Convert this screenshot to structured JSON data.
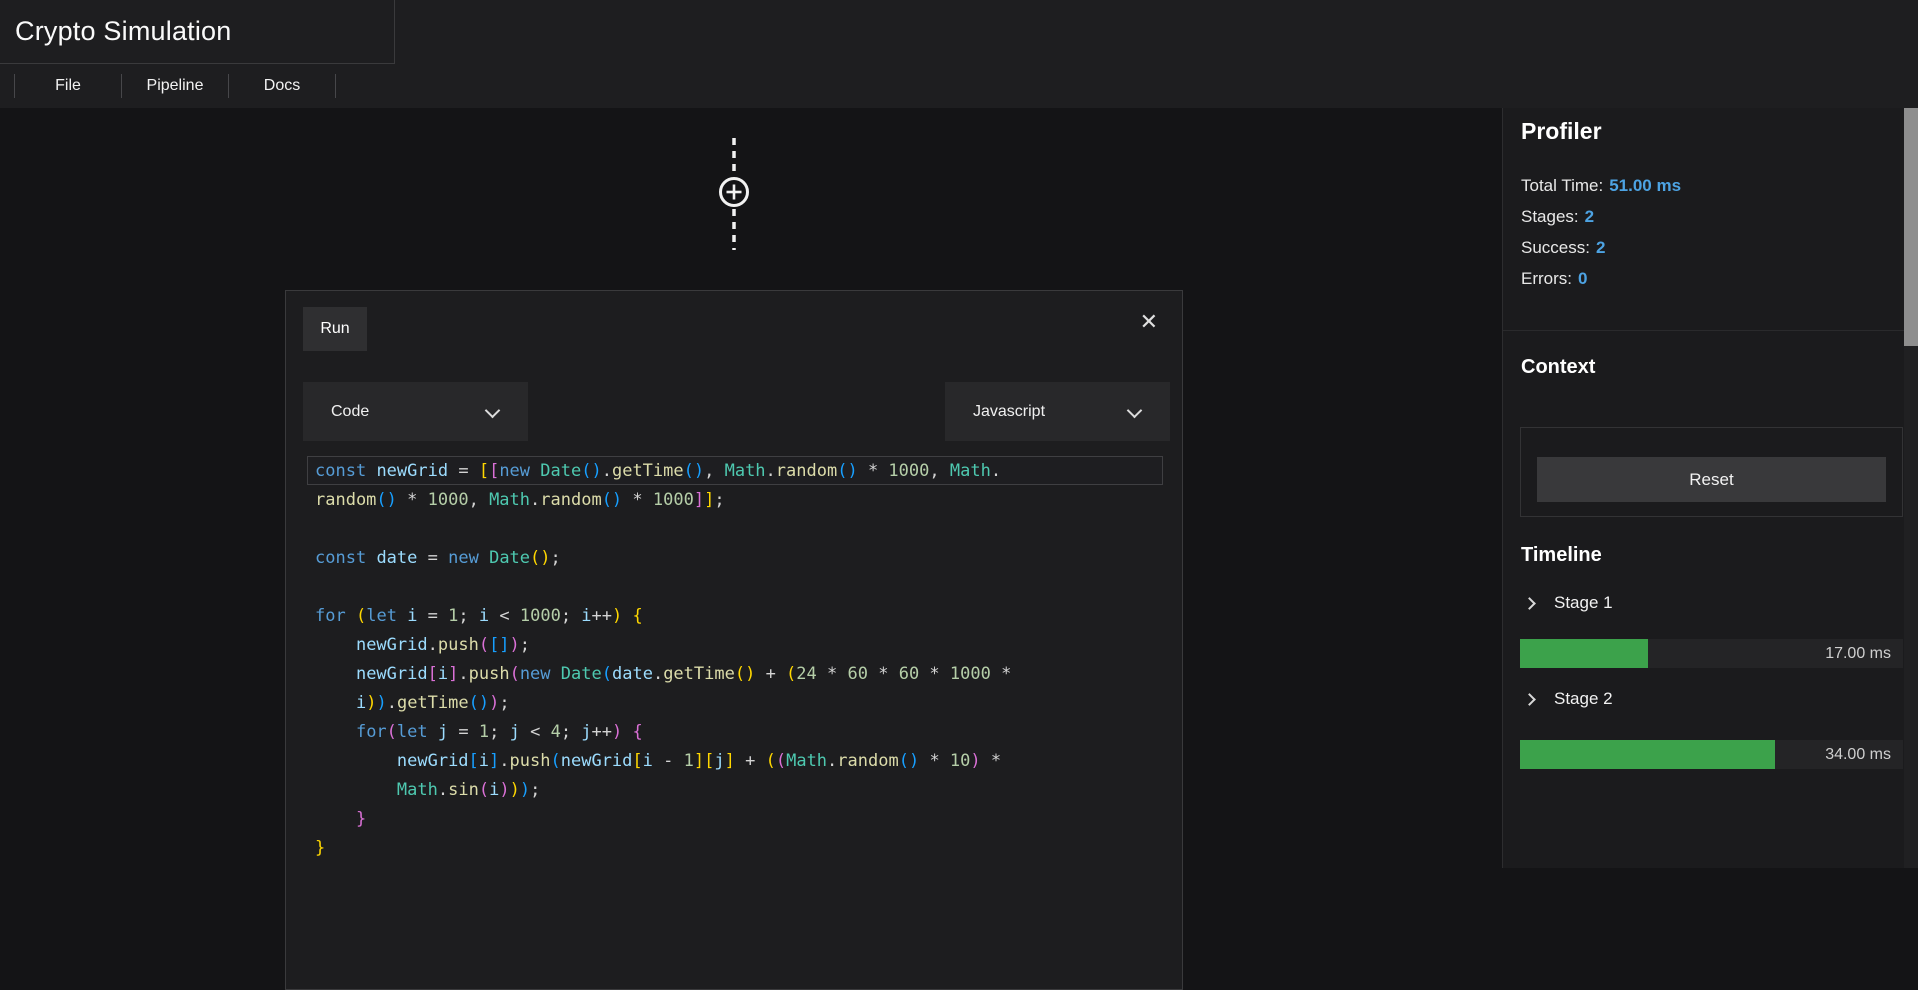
{
  "app": {
    "title": "Crypto Simulation"
  },
  "menu": {
    "items": [
      {
        "label": "File"
      },
      {
        "label": "Pipeline"
      },
      {
        "label": "Docs"
      }
    ]
  },
  "canvas": {
    "connector_icon": "circle-plus-icon"
  },
  "modal": {
    "run_label": "Run",
    "close_glyph": "✕",
    "dropdowns": [
      {
        "value": "Code"
      },
      {
        "value": "Javascript"
      }
    ],
    "code": {
      "language": "javascript",
      "rows": [
        {
          "boxed": true,
          "t": [
            [
              "kw",
              "const"
            ],
            [
              "pun",
              " "
            ],
            [
              "var",
              "newGrid"
            ],
            [
              "pun",
              " = "
            ],
            [
              "b1",
              "["
            ],
            [
              "b2",
              "["
            ],
            [
              "kw",
              "new"
            ],
            [
              "pun",
              " "
            ],
            [
              "cls",
              "Date"
            ],
            [
              "b3",
              "()"
            ],
            [
              "pun",
              "."
            ],
            [
              "fn",
              "getTime"
            ],
            [
              "b3",
              "()"
            ],
            [
              "pun",
              ", "
            ],
            [
              "cls",
              "Math"
            ],
            [
              "pun",
              "."
            ],
            [
              "fn",
              "random"
            ],
            [
              "b3",
              "()"
            ],
            [
              "pun",
              " * "
            ],
            [
              "num",
              "1000"
            ],
            [
              "pun",
              ", "
            ],
            [
              "cls",
              "Math"
            ],
            [
              "pun",
              "."
            ]
          ]
        },
        {
          "t": [
            [
              "fn",
              "random"
            ],
            [
              "b3",
              "()"
            ],
            [
              "pun",
              " * "
            ],
            [
              "num",
              "1000"
            ],
            [
              "pun",
              ", "
            ],
            [
              "cls",
              "Math"
            ],
            [
              "pun",
              "."
            ],
            [
              "fn",
              "random"
            ],
            [
              "b3",
              "()"
            ],
            [
              "pun",
              " * "
            ],
            [
              "num",
              "1000"
            ],
            [
              "b2",
              "]"
            ],
            [
              "b1",
              "]"
            ],
            [
              "pun",
              ";"
            ]
          ]
        },
        {
          "t": []
        },
        {
          "t": [
            [
              "kw",
              "const"
            ],
            [
              "pun",
              " "
            ],
            [
              "var",
              "date"
            ],
            [
              "pun",
              " = "
            ],
            [
              "kw",
              "new"
            ],
            [
              "pun",
              " "
            ],
            [
              "cls",
              "Date"
            ],
            [
              "b1",
              "()"
            ],
            [
              "pun",
              ";"
            ]
          ]
        },
        {
          "t": []
        },
        {
          "t": [
            [
              "kw",
              "for"
            ],
            [
              "pun",
              " "
            ],
            [
              "b1",
              "("
            ],
            [
              "kw",
              "let"
            ],
            [
              "pun",
              " "
            ],
            [
              "var",
              "i"
            ],
            [
              "pun",
              " = "
            ],
            [
              "num",
              "1"
            ],
            [
              "pun",
              "; "
            ],
            [
              "var",
              "i"
            ],
            [
              "pun",
              " < "
            ],
            [
              "num",
              "1000"
            ],
            [
              "pun",
              "; "
            ],
            [
              "var",
              "i"
            ],
            [
              "pun",
              "++"
            ],
            [
              "b1",
              ")"
            ],
            [
              "pun",
              " "
            ],
            [
              "b1",
              "{"
            ]
          ]
        },
        {
          "t": [
            [
              "pun",
              "    "
            ],
            [
              "var",
              "newGrid"
            ],
            [
              "pun",
              "."
            ],
            [
              "fn",
              "push"
            ],
            [
              "b2",
              "("
            ],
            [
              "b3",
              "[]"
            ],
            [
              "b2",
              ")"
            ],
            [
              "pun",
              ";"
            ]
          ]
        },
        {
          "t": [
            [
              "pun",
              "    "
            ],
            [
              "var",
              "newGrid"
            ],
            [
              "b2",
              "["
            ],
            [
              "var",
              "i"
            ],
            [
              "b2",
              "]"
            ],
            [
              "pun",
              "."
            ],
            [
              "fn",
              "push"
            ],
            [
              "b2",
              "("
            ],
            [
              "kw",
              "new"
            ],
            [
              "pun",
              " "
            ],
            [
              "cls",
              "Date"
            ],
            [
              "b3",
              "("
            ],
            [
              "var",
              "date"
            ],
            [
              "pun",
              "."
            ],
            [
              "fn",
              "getTime"
            ],
            [
              "b1",
              "()"
            ],
            [
              "pun",
              " + "
            ],
            [
              "b1",
              "("
            ],
            [
              "num",
              "24"
            ],
            [
              "pun",
              " * "
            ],
            [
              "num",
              "60"
            ],
            [
              "pun",
              " * "
            ],
            [
              "num",
              "60"
            ],
            [
              "pun",
              " * "
            ],
            [
              "num",
              "1000"
            ],
            [
              "pun",
              " *"
            ]
          ]
        },
        {
          "t": [
            [
              "pun",
              "    "
            ],
            [
              "var",
              "i"
            ],
            [
              "b1",
              ")"
            ],
            [
              "b3",
              ")"
            ],
            [
              "pun",
              "."
            ],
            [
              "fn",
              "getTime"
            ],
            [
              "b3",
              "()"
            ],
            [
              "b2",
              ")"
            ],
            [
              "pun",
              ";"
            ]
          ]
        },
        {
          "t": [
            [
              "pun",
              "    "
            ],
            [
              "kw",
              "for"
            ],
            [
              "b2",
              "("
            ],
            [
              "kw",
              "let"
            ],
            [
              "pun",
              " "
            ],
            [
              "var",
              "j"
            ],
            [
              "pun",
              " = "
            ],
            [
              "num",
              "1"
            ],
            [
              "pun",
              "; "
            ],
            [
              "var",
              "j"
            ],
            [
              "pun",
              " < "
            ],
            [
              "num",
              "4"
            ],
            [
              "pun",
              "; "
            ],
            [
              "var",
              "j"
            ],
            [
              "pun",
              "++"
            ],
            [
              "b2",
              ")"
            ],
            [
              "pun",
              " "
            ],
            [
              "b2",
              "{"
            ]
          ]
        },
        {
          "t": [
            [
              "pun",
              "        "
            ],
            [
              "var",
              "newGrid"
            ],
            [
              "b3",
              "["
            ],
            [
              "var",
              "i"
            ],
            [
              "b3",
              "]"
            ],
            [
              "pun",
              "."
            ],
            [
              "fn",
              "push"
            ],
            [
              "b3",
              "("
            ],
            [
              "var",
              "newGrid"
            ],
            [
              "b1",
              "["
            ],
            [
              "var",
              "i"
            ],
            [
              "pun",
              " - "
            ],
            [
              "num",
              "1"
            ],
            [
              "b1",
              "]"
            ],
            [
              "b1",
              "["
            ],
            [
              "var",
              "j"
            ],
            [
              "b1",
              "]"
            ],
            [
              "pun",
              " + "
            ],
            [
              "b1",
              "("
            ],
            [
              "b2",
              "("
            ],
            [
              "cls",
              "Math"
            ],
            [
              "pun",
              "."
            ],
            [
              "fn",
              "random"
            ],
            [
              "b3",
              "()"
            ],
            [
              "pun",
              " * "
            ],
            [
              "num",
              "10"
            ],
            [
              "b2",
              ")"
            ],
            [
              "pun",
              " *"
            ]
          ]
        },
        {
          "t": [
            [
              "pun",
              "        "
            ],
            [
              "cls",
              "Math"
            ],
            [
              "pun",
              "."
            ],
            [
              "fn",
              "sin"
            ],
            [
              "b2",
              "("
            ],
            [
              "var",
              "i"
            ],
            [
              "b2",
              ")"
            ],
            [
              "b1",
              ")"
            ],
            [
              "b3",
              ")"
            ],
            [
              "pun",
              ";"
            ]
          ]
        },
        {
          "t": [
            [
              "pun",
              "    "
            ],
            [
              "b2",
              "}"
            ]
          ]
        },
        {
          "t": [
            [
              "b1",
              "}"
            ]
          ]
        }
      ]
    }
  },
  "sidebar": {
    "profiler": {
      "title": "Profiler",
      "stats": [
        {
          "label": "Total Time:",
          "value": "51.00 ms"
        },
        {
          "label": "Stages:",
          "value": "2"
        },
        {
          "label": "Success:",
          "value": "2"
        },
        {
          "label": "Errors:",
          "value": "0"
        }
      ]
    },
    "context": {
      "title": "Context",
      "reset_label": "Reset"
    },
    "timeline": {
      "title": "Timeline",
      "stages": [
        {
          "name": "Stage 1",
          "time": "17.00 ms",
          "pct": 33.3
        },
        {
          "name": "Stage 2",
          "time": "34.00 ms",
          "pct": 66.7
        }
      ]
    }
  },
  "colors": {
    "accent_blue": "#4da3e3",
    "bar_green": "#3ca24b",
    "bar_track": "#242426",
    "keyword_blue": "#569cd6",
    "class_teal": "#4ec9b0",
    "bracket_gold": "#ffd700",
    "bracket_pink": "#da70d6",
    "bracket_blue": "#179fff"
  }
}
